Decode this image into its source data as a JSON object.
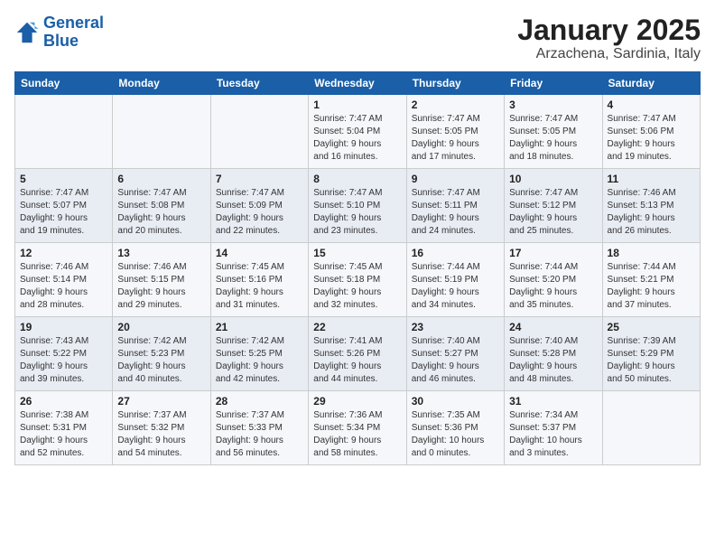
{
  "logo": {
    "line1": "General",
    "line2": "Blue"
  },
  "title": "January 2025",
  "subtitle": "Arzachena, Sardinia, Italy",
  "headers": [
    "Sunday",
    "Monday",
    "Tuesday",
    "Wednesday",
    "Thursday",
    "Friday",
    "Saturday"
  ],
  "weeks": [
    [
      {
        "day": "",
        "info": ""
      },
      {
        "day": "",
        "info": ""
      },
      {
        "day": "",
        "info": ""
      },
      {
        "day": "1",
        "info": "Sunrise: 7:47 AM\nSunset: 5:04 PM\nDaylight: 9 hours\nand 16 minutes."
      },
      {
        "day": "2",
        "info": "Sunrise: 7:47 AM\nSunset: 5:05 PM\nDaylight: 9 hours\nand 17 minutes."
      },
      {
        "day": "3",
        "info": "Sunrise: 7:47 AM\nSunset: 5:05 PM\nDaylight: 9 hours\nand 18 minutes."
      },
      {
        "day": "4",
        "info": "Sunrise: 7:47 AM\nSunset: 5:06 PM\nDaylight: 9 hours\nand 19 minutes."
      }
    ],
    [
      {
        "day": "5",
        "info": "Sunrise: 7:47 AM\nSunset: 5:07 PM\nDaylight: 9 hours\nand 19 minutes."
      },
      {
        "day": "6",
        "info": "Sunrise: 7:47 AM\nSunset: 5:08 PM\nDaylight: 9 hours\nand 20 minutes."
      },
      {
        "day": "7",
        "info": "Sunrise: 7:47 AM\nSunset: 5:09 PM\nDaylight: 9 hours\nand 22 minutes."
      },
      {
        "day": "8",
        "info": "Sunrise: 7:47 AM\nSunset: 5:10 PM\nDaylight: 9 hours\nand 23 minutes."
      },
      {
        "day": "9",
        "info": "Sunrise: 7:47 AM\nSunset: 5:11 PM\nDaylight: 9 hours\nand 24 minutes."
      },
      {
        "day": "10",
        "info": "Sunrise: 7:47 AM\nSunset: 5:12 PM\nDaylight: 9 hours\nand 25 minutes."
      },
      {
        "day": "11",
        "info": "Sunrise: 7:46 AM\nSunset: 5:13 PM\nDaylight: 9 hours\nand 26 minutes."
      }
    ],
    [
      {
        "day": "12",
        "info": "Sunrise: 7:46 AM\nSunset: 5:14 PM\nDaylight: 9 hours\nand 28 minutes."
      },
      {
        "day": "13",
        "info": "Sunrise: 7:46 AM\nSunset: 5:15 PM\nDaylight: 9 hours\nand 29 minutes."
      },
      {
        "day": "14",
        "info": "Sunrise: 7:45 AM\nSunset: 5:16 PM\nDaylight: 9 hours\nand 31 minutes."
      },
      {
        "day": "15",
        "info": "Sunrise: 7:45 AM\nSunset: 5:18 PM\nDaylight: 9 hours\nand 32 minutes."
      },
      {
        "day": "16",
        "info": "Sunrise: 7:44 AM\nSunset: 5:19 PM\nDaylight: 9 hours\nand 34 minutes."
      },
      {
        "day": "17",
        "info": "Sunrise: 7:44 AM\nSunset: 5:20 PM\nDaylight: 9 hours\nand 35 minutes."
      },
      {
        "day": "18",
        "info": "Sunrise: 7:44 AM\nSunset: 5:21 PM\nDaylight: 9 hours\nand 37 minutes."
      }
    ],
    [
      {
        "day": "19",
        "info": "Sunrise: 7:43 AM\nSunset: 5:22 PM\nDaylight: 9 hours\nand 39 minutes."
      },
      {
        "day": "20",
        "info": "Sunrise: 7:42 AM\nSunset: 5:23 PM\nDaylight: 9 hours\nand 40 minutes."
      },
      {
        "day": "21",
        "info": "Sunrise: 7:42 AM\nSunset: 5:25 PM\nDaylight: 9 hours\nand 42 minutes."
      },
      {
        "day": "22",
        "info": "Sunrise: 7:41 AM\nSunset: 5:26 PM\nDaylight: 9 hours\nand 44 minutes."
      },
      {
        "day": "23",
        "info": "Sunrise: 7:40 AM\nSunset: 5:27 PM\nDaylight: 9 hours\nand 46 minutes."
      },
      {
        "day": "24",
        "info": "Sunrise: 7:40 AM\nSunset: 5:28 PM\nDaylight: 9 hours\nand 48 minutes."
      },
      {
        "day": "25",
        "info": "Sunrise: 7:39 AM\nSunset: 5:29 PM\nDaylight: 9 hours\nand 50 minutes."
      }
    ],
    [
      {
        "day": "26",
        "info": "Sunrise: 7:38 AM\nSunset: 5:31 PM\nDaylight: 9 hours\nand 52 minutes."
      },
      {
        "day": "27",
        "info": "Sunrise: 7:37 AM\nSunset: 5:32 PM\nDaylight: 9 hours\nand 54 minutes."
      },
      {
        "day": "28",
        "info": "Sunrise: 7:37 AM\nSunset: 5:33 PM\nDaylight: 9 hours\nand 56 minutes."
      },
      {
        "day": "29",
        "info": "Sunrise: 7:36 AM\nSunset: 5:34 PM\nDaylight: 9 hours\nand 58 minutes."
      },
      {
        "day": "30",
        "info": "Sunrise: 7:35 AM\nSunset: 5:36 PM\nDaylight: 10 hours\nand 0 minutes."
      },
      {
        "day": "31",
        "info": "Sunrise: 7:34 AM\nSunset: 5:37 PM\nDaylight: 10 hours\nand 3 minutes."
      },
      {
        "day": "",
        "info": ""
      }
    ]
  ]
}
